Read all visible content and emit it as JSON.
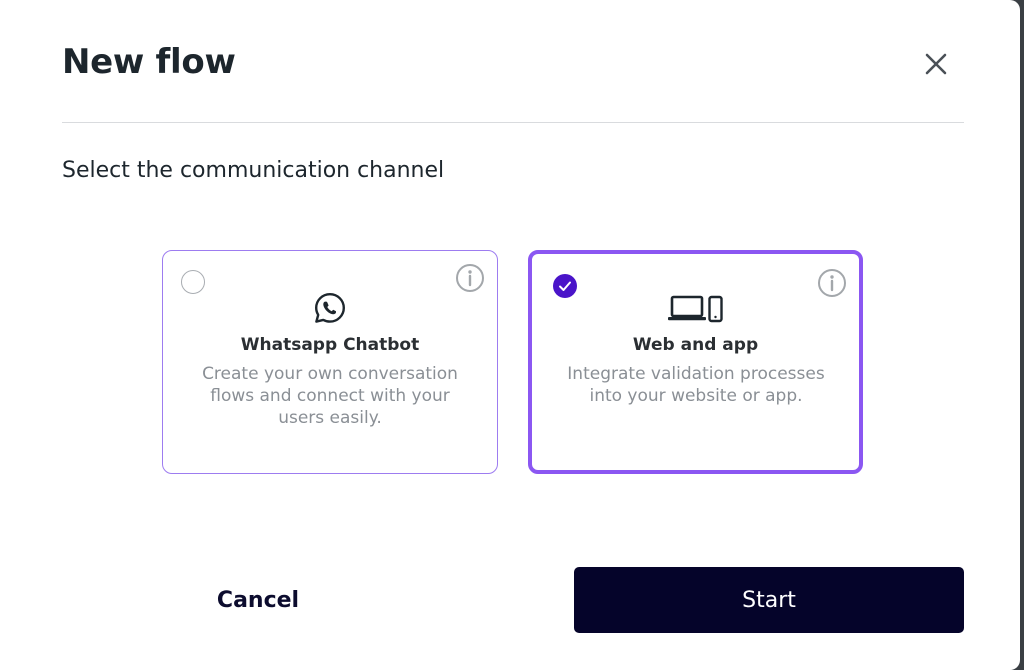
{
  "modal": {
    "title": "New flow",
    "subtitle": "Select the communication channel"
  },
  "channels": [
    {
      "id": "whatsapp",
      "title": "Whatsapp Chatbot",
      "description": "Create your own conversation flows and connect with your users easily.",
      "selected": false,
      "icon": "whatsapp-icon"
    },
    {
      "id": "web",
      "title": "Web and app",
      "description": "Integrate validation processes into your website or app.",
      "selected": true,
      "icon": "laptop-phone-icon"
    }
  ],
  "footer": {
    "cancel_label": "Cancel",
    "start_label": "Start"
  },
  "colors": {
    "accent": "#8b57f2",
    "selected_check": "#4a14c9",
    "primary_button": "#05042a"
  }
}
